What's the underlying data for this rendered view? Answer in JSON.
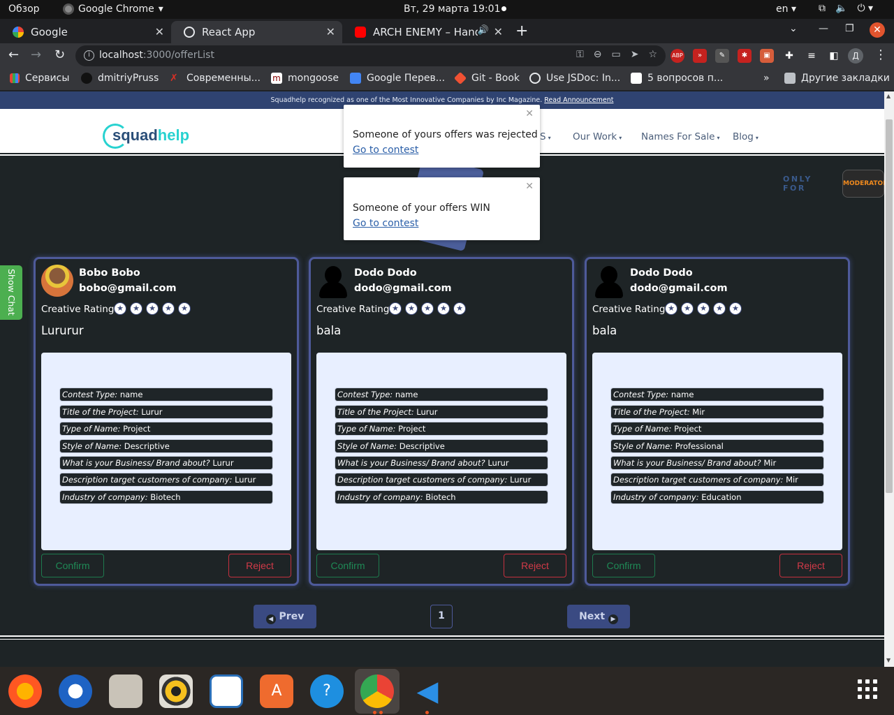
{
  "system_bar": {
    "overview": "Обзор",
    "app_name": "Google Chrome",
    "datetime": "Вт, 29 марта  19:01",
    "language": "en"
  },
  "tabs": [
    {
      "title": "Google"
    },
    {
      "title": "React App"
    },
    {
      "title": "ARCH ENEMY – Hands"
    }
  ],
  "address_bar": {
    "host": "localhost",
    "path": ":3000/offerList"
  },
  "profile_initial": "Д",
  "extensions": [
    "ABP"
  ],
  "bookmarks": [
    {
      "label": "Сервисы"
    },
    {
      "label": "dmitriyPruss"
    },
    {
      "label": "Современны..."
    },
    {
      "label": "mongoose"
    },
    {
      "label": "Google Перев..."
    },
    {
      "label": "Git - Book"
    },
    {
      "label": "Use JSDoc: In..."
    },
    {
      "label": "5 вопросов п..."
    },
    {
      "label": "»"
    },
    {
      "label": "Другие закладки"
    }
  ],
  "announcement": {
    "text": "Squadhelp recognized as one of the Most Innovative Companies by Inc Magazine.",
    "link": "Read Announcement"
  },
  "logo": {
    "part1": "squad",
    "part2": "help"
  },
  "nav": [
    {
      "label": "S"
    },
    {
      "label": "Our Work"
    },
    {
      "label": "Names For Sale"
    },
    {
      "label": "Blog"
    }
  ],
  "moderator": {
    "only_for": "ONLY FOR",
    "badge": "MODERATOR"
  },
  "offers": [
    {
      "name": "Bobo Bobo",
      "email": "bobo@gmail.com",
      "rating_label": "Creative Rating",
      "text": "Lururur",
      "details": [
        {
          "label": "Contest Type:",
          "value": "name"
        },
        {
          "label": "Title of the Project:",
          "value": "Lurur"
        },
        {
          "label": "Type of Name:",
          "value": "Project"
        },
        {
          "label": "Style of Name:",
          "value": "Descriptive"
        },
        {
          "label": "What is your Business/ Brand about?",
          "value": "Lurur"
        },
        {
          "label": "Description target customers of company:",
          "value": "Lurur"
        },
        {
          "label": "Industry of company:",
          "value": "Biotech"
        }
      ],
      "confirm": "Confirm",
      "reject": "Reject"
    },
    {
      "name": "Dodo Dodo",
      "email": "dodo@gmail.com",
      "rating_label": "Creative Rating",
      "text": "bala",
      "details": [
        {
          "label": "Contest Type:",
          "value": "name"
        },
        {
          "label": "Title of the Project:",
          "value": "Lurur"
        },
        {
          "label": "Type of Name:",
          "value": "Project"
        },
        {
          "label": "Style of Name:",
          "value": "Descriptive"
        },
        {
          "label": "What is your Business/ Brand about?",
          "value": "Lurur"
        },
        {
          "label": "Description target customers of company:",
          "value": "Lurur"
        },
        {
          "label": "Industry of company:",
          "value": "Biotech"
        }
      ],
      "confirm": "Confirm",
      "reject": "Reject"
    },
    {
      "name": "Dodo Dodo",
      "email": "dodo@gmail.com",
      "rating_label": "Creative Rating",
      "text": "bala",
      "details": [
        {
          "label": "Contest Type:",
          "value": "name"
        },
        {
          "label": "Title of the Project:",
          "value": "Mir"
        },
        {
          "label": "Type of Name:",
          "value": "Project"
        },
        {
          "label": "Style of Name:",
          "value": "Professional"
        },
        {
          "label": "What is your Business/ Brand about?",
          "value": "Mir"
        },
        {
          "label": "Description target customers of company:",
          "value": "Mir"
        },
        {
          "label": "Industry of company:",
          "value": "Education"
        }
      ],
      "confirm": "Confirm",
      "reject": "Reject"
    }
  ],
  "pagination": {
    "prev": "Prev",
    "page": "1",
    "next": "Next"
  },
  "show_chat": "Show Chat",
  "toasts": [
    {
      "message": "Someone of yours offers was rejected",
      "link": "Go to contest"
    },
    {
      "message": "Someone of your offers WIN",
      "link": "Go to contest"
    }
  ],
  "colors": {
    "page_bg": "#1e2426",
    "card_border": "#4e5a9a",
    "confirm": "#1f8a56",
    "reject": "#d23a48",
    "accent": "#3a4a82",
    "logo_teal": "#28d2d0"
  },
  "dock_apps": [
    "firefox-icon",
    "thunderbird-icon",
    "files-icon",
    "rhythmbox-icon",
    "writer-icon",
    "app-store-icon",
    "help-icon",
    "chrome-icon",
    "vscode-icon"
  ]
}
